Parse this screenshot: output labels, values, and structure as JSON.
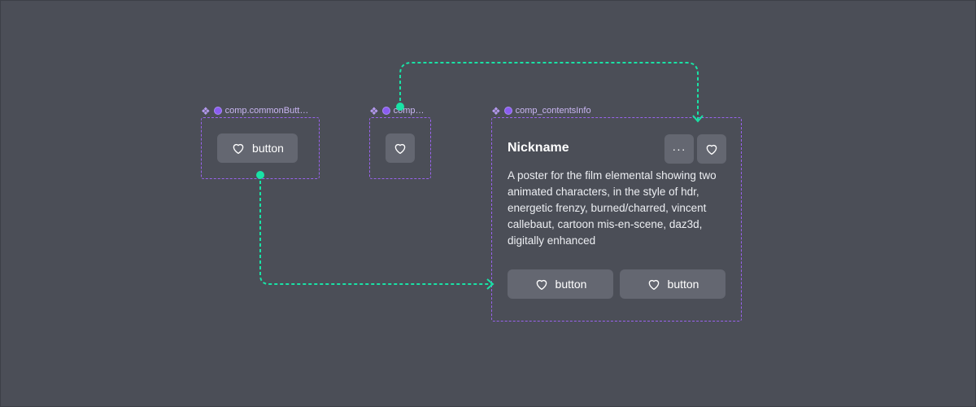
{
  "components": {
    "common_button": {
      "label": "comp.commonButt…",
      "button_label": "button"
    },
    "icon_button": {
      "label": "comp…"
    },
    "contents_info": {
      "label": "comp_contentsInfo",
      "title": "Nickname",
      "more_glyph": "···",
      "description": "A poster for the film elemental showing two animated characters, in the style of hdr, energetic frenzy, burned/charred, vincent callebaut, cartoon mis-en-scene, daz3d, digitally enhanced",
      "buttons": [
        {
          "label": "button"
        },
        {
          "label": "button"
        }
      ]
    }
  },
  "icons": {
    "component": "diamond-component-icon",
    "instance": "instance-dot-icon",
    "heart": "heart-icon",
    "more": "more-horizontal-icon"
  },
  "colors": {
    "canvas": "#4b4e57",
    "dashed_border": "#9a63ee",
    "connector": "#19e3a6",
    "button": "#646771",
    "label": "#c9b6f2"
  }
}
